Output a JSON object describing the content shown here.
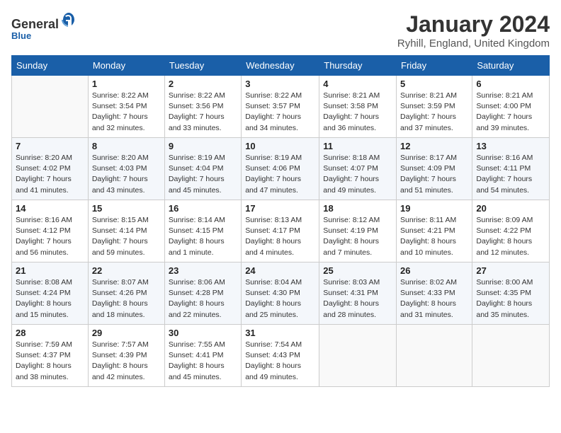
{
  "logo": {
    "general": "General",
    "blue": "Blue"
  },
  "title": "January 2024",
  "location": "Ryhill, England, United Kingdom",
  "days_of_week": [
    "Sunday",
    "Monday",
    "Tuesday",
    "Wednesday",
    "Thursday",
    "Friday",
    "Saturday"
  ],
  "weeks": [
    [
      {
        "day": "",
        "sunrise": "",
        "sunset": "",
        "daylight": ""
      },
      {
        "day": "1",
        "sunrise": "Sunrise: 8:22 AM",
        "sunset": "Sunset: 3:54 PM",
        "daylight": "Daylight: 7 hours and 32 minutes."
      },
      {
        "day": "2",
        "sunrise": "Sunrise: 8:22 AM",
        "sunset": "Sunset: 3:56 PM",
        "daylight": "Daylight: 7 hours and 33 minutes."
      },
      {
        "day": "3",
        "sunrise": "Sunrise: 8:22 AM",
        "sunset": "Sunset: 3:57 PM",
        "daylight": "Daylight: 7 hours and 34 minutes."
      },
      {
        "day": "4",
        "sunrise": "Sunrise: 8:21 AM",
        "sunset": "Sunset: 3:58 PM",
        "daylight": "Daylight: 7 hours and 36 minutes."
      },
      {
        "day": "5",
        "sunrise": "Sunrise: 8:21 AM",
        "sunset": "Sunset: 3:59 PM",
        "daylight": "Daylight: 7 hours and 37 minutes."
      },
      {
        "day": "6",
        "sunrise": "Sunrise: 8:21 AM",
        "sunset": "Sunset: 4:00 PM",
        "daylight": "Daylight: 7 hours and 39 minutes."
      }
    ],
    [
      {
        "day": "7",
        "sunrise": "Sunrise: 8:20 AM",
        "sunset": "Sunset: 4:02 PM",
        "daylight": "Daylight: 7 hours and 41 minutes."
      },
      {
        "day": "8",
        "sunrise": "Sunrise: 8:20 AM",
        "sunset": "Sunset: 4:03 PM",
        "daylight": "Daylight: 7 hours and 43 minutes."
      },
      {
        "day": "9",
        "sunrise": "Sunrise: 8:19 AM",
        "sunset": "Sunset: 4:04 PM",
        "daylight": "Daylight: 7 hours and 45 minutes."
      },
      {
        "day": "10",
        "sunrise": "Sunrise: 8:19 AM",
        "sunset": "Sunset: 4:06 PM",
        "daylight": "Daylight: 7 hours and 47 minutes."
      },
      {
        "day": "11",
        "sunrise": "Sunrise: 8:18 AM",
        "sunset": "Sunset: 4:07 PM",
        "daylight": "Daylight: 7 hours and 49 minutes."
      },
      {
        "day": "12",
        "sunrise": "Sunrise: 8:17 AM",
        "sunset": "Sunset: 4:09 PM",
        "daylight": "Daylight: 7 hours and 51 minutes."
      },
      {
        "day": "13",
        "sunrise": "Sunrise: 8:16 AM",
        "sunset": "Sunset: 4:11 PM",
        "daylight": "Daylight: 7 hours and 54 minutes."
      }
    ],
    [
      {
        "day": "14",
        "sunrise": "Sunrise: 8:16 AM",
        "sunset": "Sunset: 4:12 PM",
        "daylight": "Daylight: 7 hours and 56 minutes."
      },
      {
        "day": "15",
        "sunrise": "Sunrise: 8:15 AM",
        "sunset": "Sunset: 4:14 PM",
        "daylight": "Daylight: 7 hours and 59 minutes."
      },
      {
        "day": "16",
        "sunrise": "Sunrise: 8:14 AM",
        "sunset": "Sunset: 4:15 PM",
        "daylight": "Daylight: 8 hours and 1 minute."
      },
      {
        "day": "17",
        "sunrise": "Sunrise: 8:13 AM",
        "sunset": "Sunset: 4:17 PM",
        "daylight": "Daylight: 8 hours and 4 minutes."
      },
      {
        "day": "18",
        "sunrise": "Sunrise: 8:12 AM",
        "sunset": "Sunset: 4:19 PM",
        "daylight": "Daylight: 8 hours and 7 minutes."
      },
      {
        "day": "19",
        "sunrise": "Sunrise: 8:11 AM",
        "sunset": "Sunset: 4:21 PM",
        "daylight": "Daylight: 8 hours and 10 minutes."
      },
      {
        "day": "20",
        "sunrise": "Sunrise: 8:09 AM",
        "sunset": "Sunset: 4:22 PM",
        "daylight": "Daylight: 8 hours and 12 minutes."
      }
    ],
    [
      {
        "day": "21",
        "sunrise": "Sunrise: 8:08 AM",
        "sunset": "Sunset: 4:24 PM",
        "daylight": "Daylight: 8 hours and 15 minutes."
      },
      {
        "day": "22",
        "sunrise": "Sunrise: 8:07 AM",
        "sunset": "Sunset: 4:26 PM",
        "daylight": "Daylight: 8 hours and 18 minutes."
      },
      {
        "day": "23",
        "sunrise": "Sunrise: 8:06 AM",
        "sunset": "Sunset: 4:28 PM",
        "daylight": "Daylight: 8 hours and 22 minutes."
      },
      {
        "day": "24",
        "sunrise": "Sunrise: 8:04 AM",
        "sunset": "Sunset: 4:30 PM",
        "daylight": "Daylight: 8 hours and 25 minutes."
      },
      {
        "day": "25",
        "sunrise": "Sunrise: 8:03 AM",
        "sunset": "Sunset: 4:31 PM",
        "daylight": "Daylight: 8 hours and 28 minutes."
      },
      {
        "day": "26",
        "sunrise": "Sunrise: 8:02 AM",
        "sunset": "Sunset: 4:33 PM",
        "daylight": "Daylight: 8 hours and 31 minutes."
      },
      {
        "day": "27",
        "sunrise": "Sunrise: 8:00 AM",
        "sunset": "Sunset: 4:35 PM",
        "daylight": "Daylight: 8 hours and 35 minutes."
      }
    ],
    [
      {
        "day": "28",
        "sunrise": "Sunrise: 7:59 AM",
        "sunset": "Sunset: 4:37 PM",
        "daylight": "Daylight: 8 hours and 38 minutes."
      },
      {
        "day": "29",
        "sunrise": "Sunrise: 7:57 AM",
        "sunset": "Sunset: 4:39 PM",
        "daylight": "Daylight: 8 hours and 42 minutes."
      },
      {
        "day": "30",
        "sunrise": "Sunrise: 7:55 AM",
        "sunset": "Sunset: 4:41 PM",
        "daylight": "Daylight: 8 hours and 45 minutes."
      },
      {
        "day": "31",
        "sunrise": "Sunrise: 7:54 AM",
        "sunset": "Sunset: 4:43 PM",
        "daylight": "Daylight: 8 hours and 49 minutes."
      },
      {
        "day": "",
        "sunrise": "",
        "sunset": "",
        "daylight": ""
      },
      {
        "day": "",
        "sunrise": "",
        "sunset": "",
        "daylight": ""
      },
      {
        "day": "",
        "sunrise": "",
        "sunset": "",
        "daylight": ""
      }
    ]
  ]
}
